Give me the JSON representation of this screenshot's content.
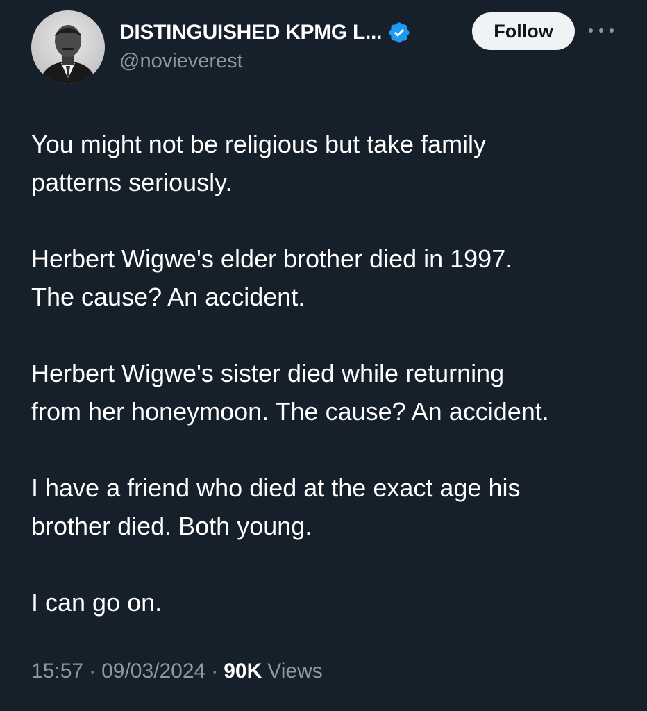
{
  "author": {
    "display_name": "DISTINGUISHED KPMG L...",
    "handle": "@novieverest",
    "verified": true,
    "avatar_icon": "profile-photo",
    "verified_color": "#1d9bf0"
  },
  "actions": {
    "follow_label": "Follow",
    "more_icon": "more-dots-icon"
  },
  "tweet": {
    "paragraphs": [
      "You might not be religious but take family\npatterns seriously.",
      "Herbert Wigwe's elder brother died in 1997.\nThe cause? An accident.",
      "Herbert Wigwe's sister died while returning\nfrom her honeymoon. The cause? An accident.",
      "I have a friend who died at the exact age his\nbrother died. Both young.",
      "I can go on."
    ]
  },
  "meta": {
    "time": "15:57",
    "separator": "·",
    "date": "09/03/2024",
    "views_count": "90K",
    "views_label": "Views"
  },
  "colors": {
    "background": "#15202b",
    "text": "#ffffff",
    "secondary_text": "#8b98a5",
    "follow_button_bg": "#eff3f4"
  }
}
